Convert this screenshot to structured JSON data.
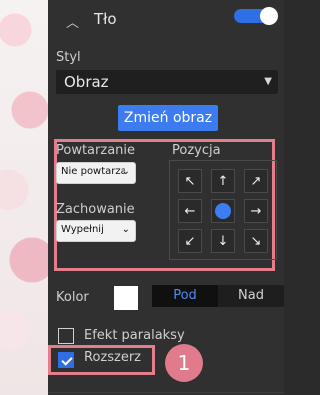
{
  "section": {
    "title": "Tło",
    "style_label": "Styl",
    "style_value": "Obraz",
    "change_image_button": "Zmień obraz"
  },
  "repeat": {
    "label": "Powtarzanie",
    "value": "Nie powtarzaj"
  },
  "behavior": {
    "label": "Zachowanie",
    "value": "Wypełnij"
  },
  "position": {
    "label": "Pozycja",
    "cells": [
      "↖",
      "↑",
      "↗",
      "←",
      "",
      "→",
      "↙",
      "↓",
      "↘"
    ]
  },
  "color": {
    "label": "Kolor",
    "opt_under": "Pod",
    "opt_over": "Nad"
  },
  "parallax": {
    "label": "Efekt paralaksy"
  },
  "expand": {
    "label": "Rozszerz"
  },
  "badge": "1",
  "colors": {
    "accent": "#3c7cf0",
    "highlight": "#e37e8c",
    "panel": "#303030"
  }
}
